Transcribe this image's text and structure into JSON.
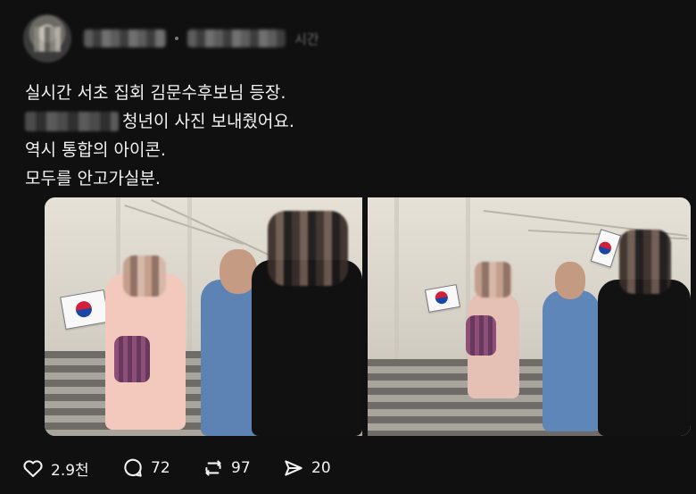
{
  "post": {
    "author_name_blurred": "",
    "handle_blurred": "",
    "timestamp": "시간",
    "text_lines": [
      "실시간 서초 집회 김문수후보님 등장.",
      "청년이 사진 보내줬어요.",
      "역시 통합의 아이콘.",
      "모두를 안고가실분."
    ],
    "redacted_prefix_line2": "",
    "redacted_char_line2": "청"
  },
  "media": {
    "count": 2,
    "selected_index": 1
  },
  "actions": {
    "likes": "2.9천",
    "comments": "72",
    "reposts": "97",
    "shares": "20"
  },
  "icons": {
    "like": "heart-icon",
    "comment": "comment-icon",
    "repost": "repost-icon",
    "share": "send-icon"
  },
  "colors": {
    "background": "#101010",
    "text": "#f2f2f2",
    "selection": "#1d9bf0"
  }
}
